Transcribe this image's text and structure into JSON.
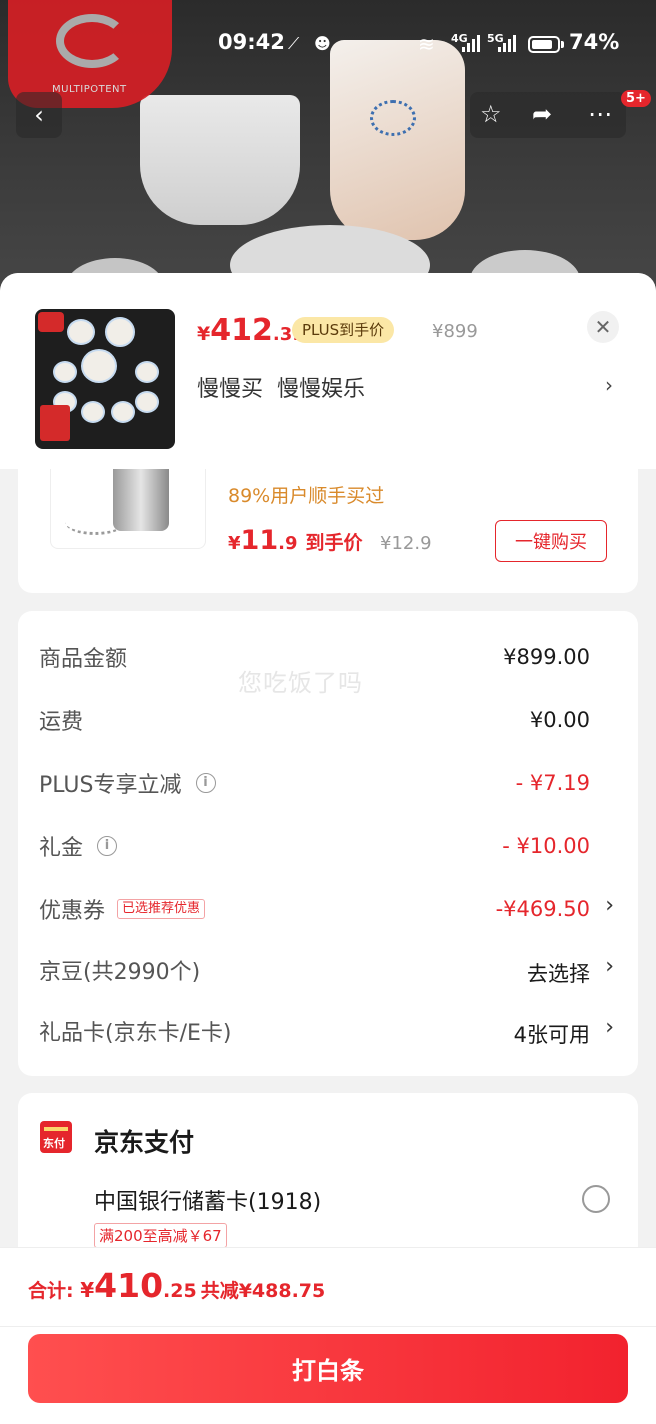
{
  "status_bar": {
    "time": "09:42",
    "battery": "74%",
    "net1": "4G",
    "net2": "5G"
  },
  "brand": {
    "logo_text": "MULTIPOTENT"
  },
  "nav": {
    "notification_count": "5+"
  },
  "product": {
    "price_symbol": "¥",
    "price_int": "412",
    "price_dec": ".31",
    "plus_tag": "PLUS到手价",
    "original_price": "¥899",
    "spec": "慢慢买  慢慢娱乐"
  },
  "addon": {
    "rate_text": "89%用户顺手买过",
    "price_symbol": "¥",
    "price_int": "11",
    "price_dec": ".9",
    "price_label": "到手价",
    "original_price": "¥12.9",
    "buy_label": "一键购买"
  },
  "summary": {
    "watermark": "您吃饭了吗",
    "rows": [
      {
        "label": "商品金额",
        "value": "¥899.00"
      },
      {
        "label": "运费",
        "value": "¥0.00"
      },
      {
        "label": "PLUS专享立减",
        "value": "- ¥7.19"
      },
      {
        "label": "礼金",
        "value": "- ¥10.00"
      },
      {
        "label": "优惠券",
        "tag": "已选推荐优惠",
        "value": "-¥469.50"
      },
      {
        "label": "京豆(共2990个)",
        "value": "去选择"
      },
      {
        "label": "礼品卡(京东卡/E卡)",
        "value": "4张可用"
      }
    ]
  },
  "payment": {
    "title": "京东支付",
    "icon_text": "东付",
    "bank": "中国银行储蓄卡(1918)",
    "promo": "满200至高减￥67"
  },
  "footer": {
    "total_label": "合计: ",
    "price_symbol": "¥",
    "total_int": "410",
    "total_dec": ".25",
    "saving": "共减¥488.75",
    "pay_label": "打白条"
  },
  "colors": {
    "accent": "#e5262c",
    "plus_gold": "#fbe7a6",
    "addon_orange": "#d98a2b"
  },
  "icons": [
    "back-arrow-icon",
    "star-icon",
    "share-icon",
    "more-icon",
    "close-icon",
    "chevron-right-icon",
    "info-icon",
    "radio-icon",
    "jd-pay-icon",
    "wifi-icon",
    "qq-icon"
  ]
}
